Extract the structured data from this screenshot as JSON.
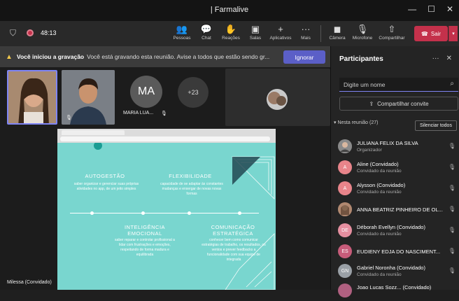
{
  "window": {
    "title": "| Farmalive",
    "controls": [
      "—",
      "☐",
      "✕"
    ]
  },
  "meeting": {
    "timer": "48:13",
    "toolbar": [
      {
        "label": "Pessoas",
        "icon": "people-icon",
        "glyph": "👥"
      },
      {
        "label": "Chat",
        "icon": "chat-icon",
        "glyph": "💬"
      },
      {
        "label": "Reações",
        "icon": "reactions-icon",
        "glyph": "✋"
      },
      {
        "label": "Salas",
        "icon": "rooms-icon",
        "glyph": "▣"
      },
      {
        "label": "Aplicativos",
        "icon": "apps-icon",
        "glyph": "+"
      },
      {
        "label": "Mais",
        "icon": "more-icon",
        "glyph": "···"
      },
      {
        "label": "Câmera",
        "icon": "camera-off-icon",
        "glyph": "◼"
      },
      {
        "label": "Microfone",
        "icon": "mic-off-icon",
        "glyph": "🎙"
      },
      {
        "label": "Compartilhar",
        "icon": "share-icon",
        "glyph": "⇧"
      }
    ],
    "leave_label": "Sair"
  },
  "banner": {
    "bold": "Você iniciou a gravação",
    "message": "Você está gravando esta reunião. Avise a todos que estão sendo gr...",
    "ignore_label": "Ignorar"
  },
  "stage": {
    "avatar_initials": "MA",
    "avatar_name": "MARIA LUA...",
    "overflow_count": "+23",
    "presenter_label": "Milessa (Convidado)"
  },
  "slide": {
    "sections": [
      {
        "title": "AUTOGESTÃO",
        "body": "saber organizar e gerenciar suas próprias atividades no app, de um jeito simples"
      },
      {
        "title": "FLEXIBILIDADE",
        "body": "capacidade de se adaptar às constantes mudanças e enxergar de novas novas formas"
      },
      {
        "title": "INTELIGÊNCIA EMOCIONAL",
        "body": "saber reparar e controlar profissional a lidar com frustrações e emoções, respeitando de forma madura e equilibrada"
      },
      {
        "title": "COMUNICAÇÃO ESTRATÉGICA",
        "body": "conhecer bem como comunicar estratégias de trabalho, os resultados, os ventos e prever feedbacks a funcionalidade com sua equipe de integrada"
      }
    ]
  },
  "participants": {
    "title": "Participantes",
    "search_placeholder": "Digite um nome",
    "share_invite": "Compartilhar convite",
    "section": "Nesta reunião (27)",
    "mute_all": "Silenciar todos",
    "people": [
      {
        "name": "JULIANA FELIX DA SILVA",
        "role": "Organizador",
        "initials": "",
        "color": "#6b6b6b"
      },
      {
        "name": "Aline (Convidado)",
        "role": "Convidado da reunião",
        "initials": "A",
        "color": "#e8848a"
      },
      {
        "name": "Alysson (Convidado)",
        "role": "Convidado da reunião",
        "initials": "A",
        "color": "#e8848a"
      },
      {
        "name": "ANNA BEATRIZ PINHEIRO DE OL...",
        "role": "",
        "initials": "",
        "color": "#8a6a5a"
      },
      {
        "name": "Déborah Evellyn (Convidado)",
        "role": "Convidado da reunião",
        "initials": "DE",
        "color": "#e68fa0"
      },
      {
        "name": "EUDIENY EDJA DO NASCIMENT...",
        "role": "",
        "initials": "ES",
        "color": "#c75c7a"
      },
      {
        "name": "Gabriel Noronha (Convidado)",
        "role": "Convidado da reunião",
        "initials": "GN",
        "color": "#9aa0a6"
      },
      {
        "name": "Joao Lucas Sozz... (Convidado)",
        "role": "",
        "initials": "",
        "color": "#b06080"
      }
    ]
  }
}
